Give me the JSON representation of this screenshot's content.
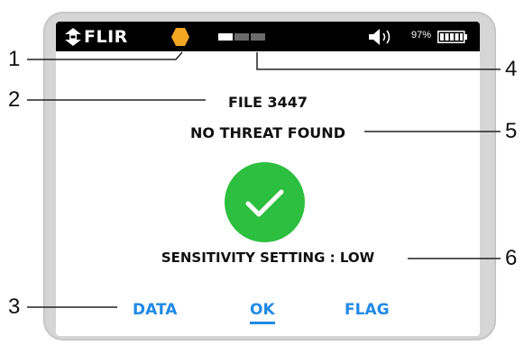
{
  "device": {
    "brand": "FLIR",
    "battery_percent": "97%",
    "signal_bars_total": 3,
    "signal_bars_lit": 1,
    "status_indicator_color": "#f5a623"
  },
  "screen": {
    "file_label": "FILE 3447",
    "result": "NO THREAT FOUND",
    "result_icon": "check-icon",
    "sensitivity": "SENSITIVITY SETTING : LOW"
  },
  "softkeys": {
    "left": "DATA",
    "center": "OK",
    "right": "FLAG",
    "active": "OK",
    "color": "#1f8ae6"
  },
  "callouts": {
    "n1": "1",
    "n2": "2",
    "n3": "3",
    "n4": "4",
    "n5": "5",
    "n6": "6"
  }
}
